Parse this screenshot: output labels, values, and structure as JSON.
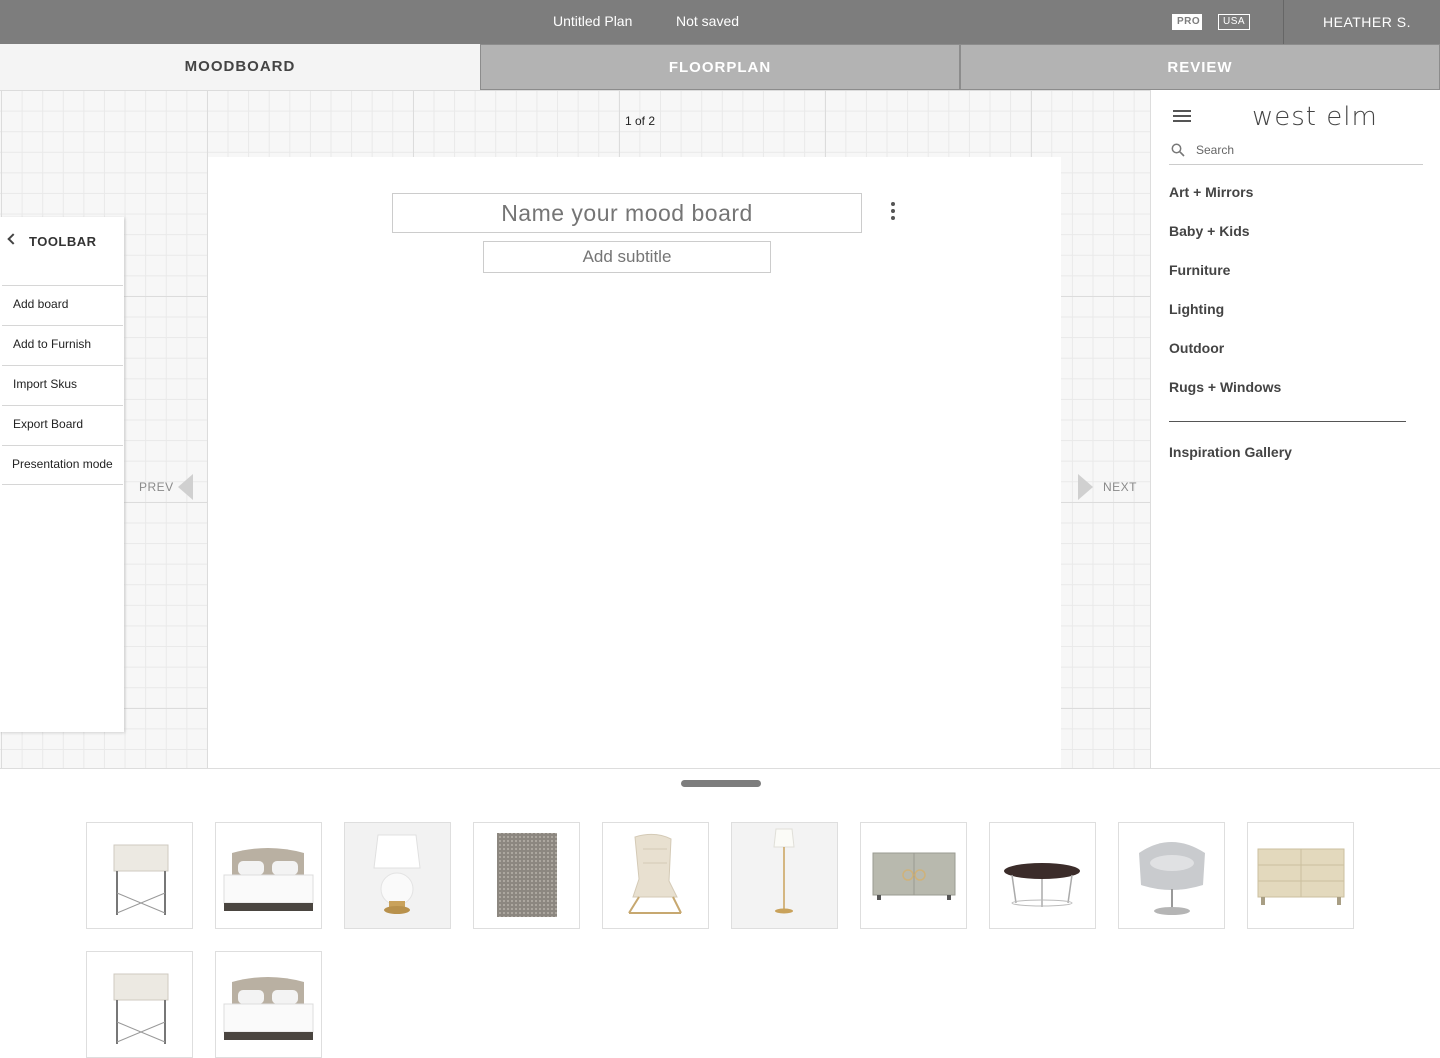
{
  "topbar": {
    "plan_name": "Untitled Plan",
    "save_status": "Not saved",
    "pro_badge": "PRO",
    "region_badge": "USA",
    "user_name": "HEATHER S."
  },
  "tabs": [
    {
      "label": "MOODBOARD",
      "active": true
    },
    {
      "label": "FLOORPLAN",
      "active": false
    },
    {
      "label": "REVIEW",
      "active": false
    }
  ],
  "canvas": {
    "page_indicator": "1 of 2",
    "title_placeholder": "Name your mood board",
    "subtitle_placeholder": "Add subtitle",
    "prev_label": "PREV",
    "next_label": "NEXT"
  },
  "toolbar": {
    "title": "TOOLBAR",
    "items": [
      {
        "label": "Add board"
      },
      {
        "label": "Add to Furnish"
      },
      {
        "label": "Import Skus"
      },
      {
        "label": "Export Board"
      },
      {
        "label": "Presentation mode"
      }
    ]
  },
  "sidebar": {
    "brand": "west elm",
    "search_placeholder": "Search",
    "categories": [
      {
        "label": "Art + Mirrors"
      },
      {
        "label": "Baby + Kids"
      },
      {
        "label": "Furniture"
      },
      {
        "label": "Lighting"
      },
      {
        "label": "Outdoor"
      },
      {
        "label": "Rugs + Windows"
      }
    ],
    "inspiration_label": "Inspiration Gallery"
  },
  "tray": {
    "products": [
      {
        "name": "side-table-icon"
      },
      {
        "name": "upholstered-bed-icon"
      },
      {
        "name": "table-lamp-icon"
      },
      {
        "name": "area-rug-icon"
      },
      {
        "name": "lounge-chair-icon"
      },
      {
        "name": "floor-lamp-icon"
      },
      {
        "name": "sideboard-icon"
      },
      {
        "name": "coffee-table-icon"
      },
      {
        "name": "swivel-chair-icon"
      },
      {
        "name": "dresser-icon"
      },
      {
        "name": "side-table-icon"
      },
      {
        "name": "upholstered-bed-icon"
      }
    ]
  },
  "colors": {
    "topbar": "#7d7d7d",
    "inactive_tab": "#b3b3b3",
    "active_tab": "#f4f4f4",
    "canvas_grid": "#f7f7f7"
  }
}
